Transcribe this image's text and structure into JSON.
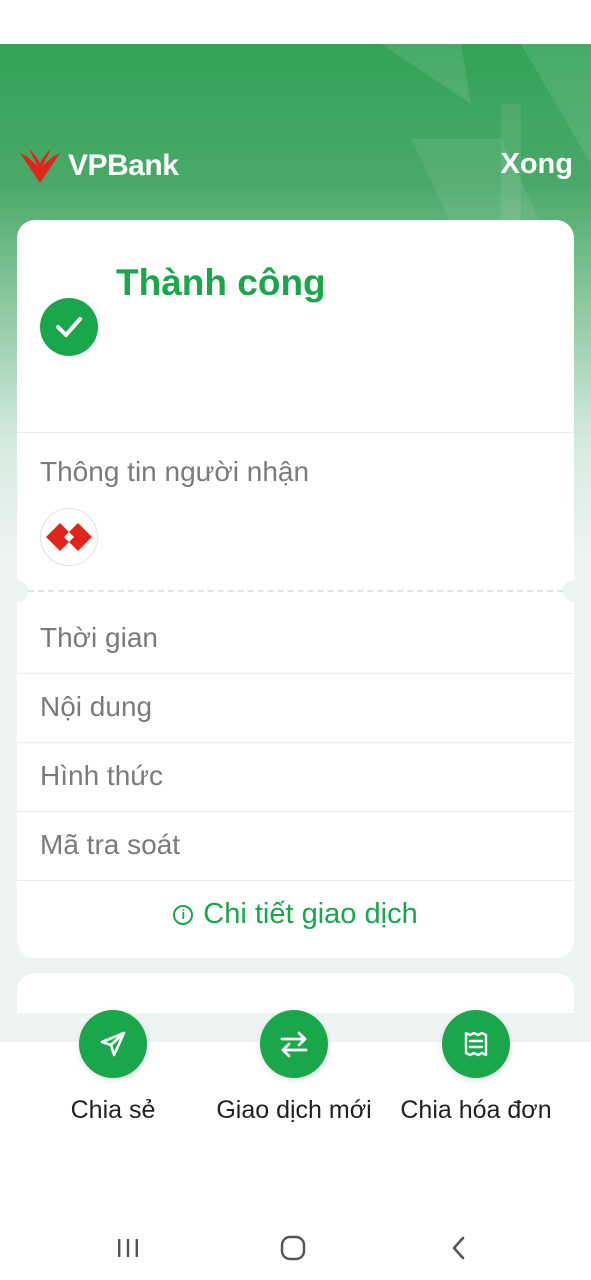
{
  "header": {
    "brand": "VPBank",
    "done_label": "Xong"
  },
  "result": {
    "title": "Thành công"
  },
  "recipient": {
    "section_label": "Thông tin người nhận"
  },
  "details": {
    "rows": [
      {
        "label": "Thời gian"
      },
      {
        "label": "Nội dung"
      },
      {
        "label": "Hình thức"
      },
      {
        "label": "Mã tra soát"
      }
    ],
    "link_label": "Chi tiết giao dịch"
  },
  "actions": [
    {
      "label": "Chia sẻ",
      "icon": "send-icon"
    },
    {
      "label": "Giao dịch mới",
      "icon": "swap-arrows-icon"
    },
    {
      "label": "Chia hóa đơn",
      "icon": "bill-split-icon"
    }
  ],
  "nav": {
    "icons": [
      "recent-apps-icon",
      "home-icon",
      "back-icon"
    ]
  },
  "colors": {
    "accent": "#1aa64b",
    "brand_red": "#e1251b",
    "header_green": "#33a356"
  }
}
